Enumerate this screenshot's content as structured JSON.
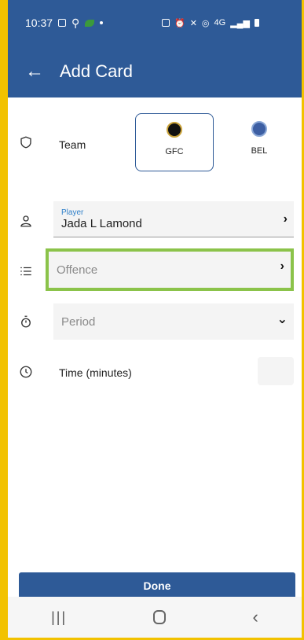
{
  "status": {
    "time": "10:37",
    "network": "4G"
  },
  "appbar": {
    "title": "Add Card"
  },
  "team": {
    "label": "Team",
    "options": [
      {
        "code": "GFC",
        "selected": true
      },
      {
        "code": "BEL",
        "selected": false
      }
    ]
  },
  "player": {
    "label": "Player",
    "value": "Jada L Lamond"
  },
  "offence": {
    "placeholder": "Offence"
  },
  "period": {
    "placeholder": "Period"
  },
  "time": {
    "label": "Time (minutes)",
    "value": ""
  },
  "actions": {
    "done_label": "Done"
  },
  "colors": {
    "primary": "#2e5a97",
    "highlight": "#8bc34a",
    "frame": "#f2c200"
  }
}
